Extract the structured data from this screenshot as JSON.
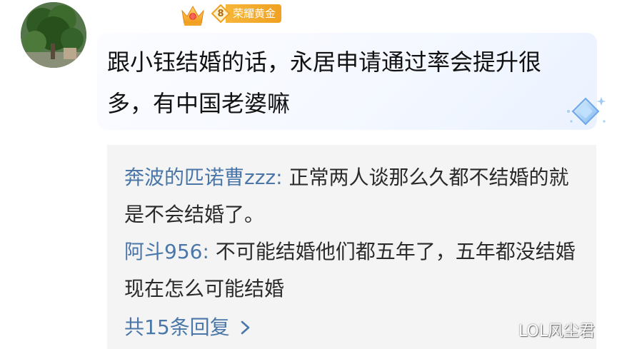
{
  "comment": {
    "badge": {
      "level": "8",
      "title": "荣耀黄金"
    },
    "text": "跟小钰结婚的话，永居申请通过率会提升很多，有中国老婆嘛"
  },
  "replies": [
    {
      "author": "奔波的匹诺曹zzz",
      "sep": ": ",
      "text": "正常两人谈那么久都不结婚的就是不会结婚了。"
    },
    {
      "author": "阿斗956",
      "sep": ": ",
      "text": "不可能结婚他们都五年了，五年都没结婚现在怎么可能结婚"
    }
  ],
  "more_replies": "共15条回复",
  "watermark": "LOL风尘君",
  "colors": {
    "author_link": "#4a77a8",
    "badge_gold": "#f0a121",
    "reply_bg": "#f4f4f5"
  }
}
